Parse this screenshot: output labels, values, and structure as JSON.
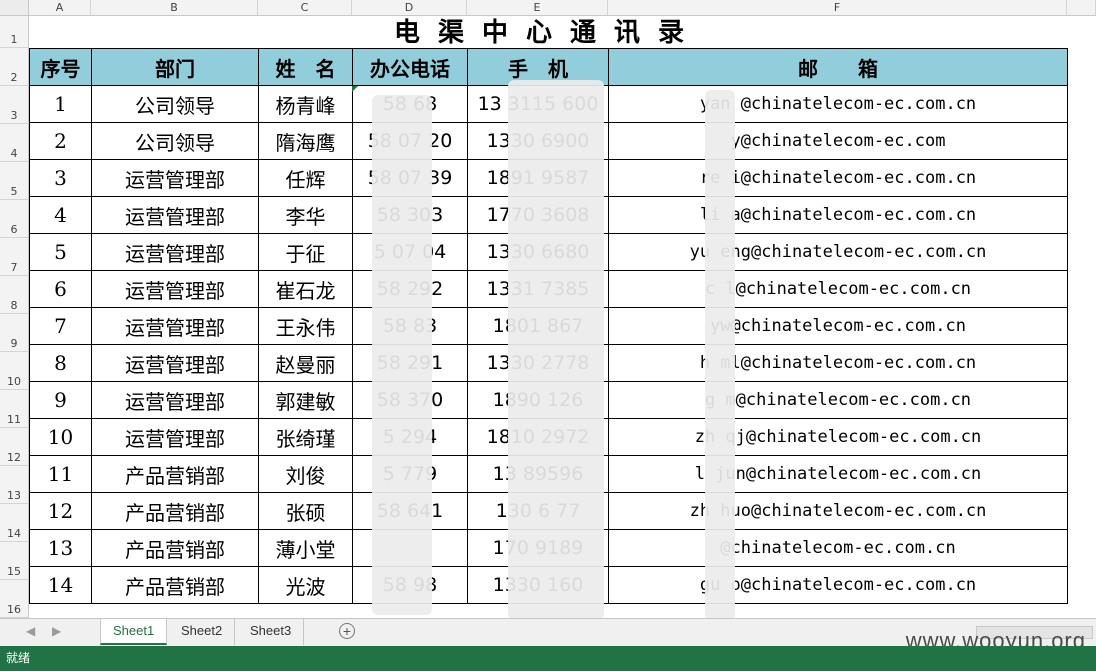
{
  "columns": [
    "A",
    "B",
    "C",
    "D",
    "E",
    "F"
  ],
  "rows": [
    "1",
    "2",
    "3",
    "4",
    "5",
    "6",
    "7",
    "8",
    "9",
    "10",
    "11",
    "12",
    "13",
    "14",
    "15",
    "16"
  ],
  "title": "电渠中心通讯录",
  "headers": [
    "序号",
    "部门",
    "姓　名",
    "办公电话",
    "手　机",
    "邮　　箱"
  ],
  "records": [
    {
      "no": "1",
      "dept": "公司领导",
      "name": "杨青峰",
      "office": "58   68",
      "mobile": "13 3115 600",
      "email": "yan  @chinatelecom-ec.com.cn"
    },
    {
      "no": "2",
      "dept": "公司领导",
      "name": "隋海鹰",
      "office": "58 07 20",
      "mobile": "1330  6900",
      "email": "  y@chinatelecom-ec.com"
    },
    {
      "no": "3",
      "dept": "运营管理部",
      "name": "任辉",
      "office": "58 07 39",
      "mobile": "1891  9587",
      "email": "re  i@chinatelecom-ec.com.cn"
    },
    {
      "no": "4",
      "dept": "运营管理部",
      "name": "李华",
      "office": "58  303",
      "mobile": "1770  3608",
      "email": "li  a@chinatelecom-ec.com.cn"
    },
    {
      "no": "5",
      "dept": "运营管理部",
      "name": "于征",
      "office": "5 07 04",
      "mobile": "1330  6680",
      "email": "yu  eng@chinatelecom-ec.com.cn"
    },
    {
      "no": "6",
      "dept": "运营管理部",
      "name": "崔石龙",
      "office": "58  292",
      "mobile": "1331  7385",
      "email": "c  l@chinatelecom-ec.com.cn"
    },
    {
      "no": "7",
      "dept": "运营管理部",
      "name": "王永伟",
      "office": "58  83",
      "mobile": "1801  867",
      "email": "  yw@chinatelecom-ec.com.cn"
    },
    {
      "no": "8",
      "dept": "运营管理部",
      "name": "赵曼丽",
      "office": "58  291",
      "mobile": "1330  2778",
      "email": "h  ml@chinatelecom-ec.com.cn"
    },
    {
      "no": "9",
      "dept": "运营管理部",
      "name": "郭建敏",
      "office": "58  370",
      "mobile": "1890  126",
      "email": "g  m@chinatelecom-ec.com.cn"
    },
    {
      "no": "10",
      "dept": "运营管理部",
      "name": "张绮瑾",
      "office": "5  294",
      "mobile": "1810  2972",
      "email": "zh  qj@chinatelecom-ec.com.cn"
    },
    {
      "no": "11",
      "dept": "产品营销部",
      "name": "刘俊",
      "office": "5  779",
      "mobile": "13  89596",
      "email": "l  jun@chinatelecom-ec.com.cn"
    },
    {
      "no": "12",
      "dept": "产品营销部",
      "name": "张硕",
      "office": "58  641",
      "mobile": "130  6 77",
      "email": "zh  huo@chinatelecom-ec.com.cn"
    },
    {
      "no": "13",
      "dept": "产品营销部",
      "name": "薄小堂",
      "office": "",
      "mobile": "170  9189",
      "email": "  @chinatelecom-ec.com.cn"
    },
    {
      "no": "14",
      "dept": "产品营销部",
      "name": "光波",
      "office": "58  98",
      "mobile": "1330  160",
      "email": "gu  o@chinatelecom-ec.com.cn"
    }
  ],
  "tabs": [
    "Sheet1",
    "Sheet2",
    "Sheet3"
  ],
  "status": "就绪",
  "watermark": "www.wooyun.org"
}
